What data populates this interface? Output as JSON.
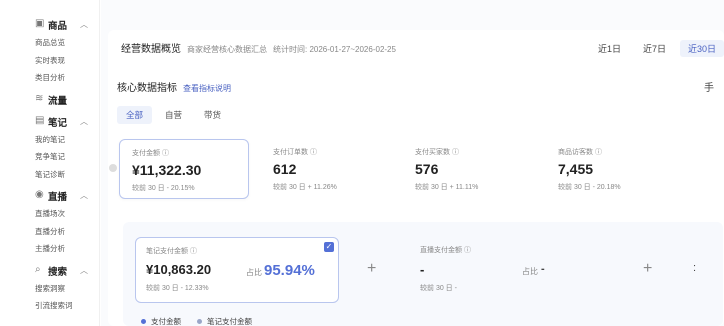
{
  "sidebar": {
    "sections": [
      {
        "label": "商品",
        "icon": "bag-icon",
        "items": [
          "商品总览",
          "实时表现",
          "类目分析"
        ]
      },
      {
        "label": "流量",
        "icon": "flow-icon",
        "items": []
      },
      {
        "label": "笔记",
        "icon": "note-icon",
        "items": [
          "我的笔记",
          "竞争笔记",
          "笔记诊断"
        ]
      },
      {
        "label": "直播",
        "icon": "live-icon",
        "items": [
          "直播场次",
          "直播分析",
          "主播分析"
        ]
      },
      {
        "label": "搜索",
        "icon": "search-icon",
        "items": [
          "搜索洞察",
          "引流搜索词"
        ]
      }
    ]
  },
  "header": {
    "title": "经营数据概览",
    "subtitle": "商家经营核心数据汇总",
    "time": "统计时间: 2026-01-27~2026-02-25"
  },
  "ranges": [
    "近1日",
    "近7日",
    "近30日"
  ],
  "core": {
    "title": "核心数据指标",
    "link": "查看指标说明",
    "right": "手"
  },
  "tabs": [
    "全部",
    "自营",
    "带货"
  ],
  "metrics": [
    {
      "label": "支付金额 ⓘ",
      "value": "¥11,322.30",
      "compare": "较前 30 日 - 20.15%"
    },
    {
      "label": "支付订单数 ⓘ",
      "value": "612",
      "compare": "较前 30 日 + 11.26%"
    },
    {
      "label": "支付买家数 ⓘ",
      "value": "576",
      "compare": "较前 30 日 + 11.11%"
    },
    {
      "label": "商品访客数 ⓘ",
      "value": "7,455",
      "compare": "较前 30 日 - 20.18%"
    }
  ],
  "lower": {
    "card1": {
      "label": "笔记支付金额 ⓘ",
      "value": "¥10,863.20",
      "ratio_label": "占比",
      "ratio": "95.94%",
      "compare": "较前 30 日 - 12.33%"
    },
    "card2": {
      "label": "直播支付金额 ⓘ",
      "value": "-",
      "ratio_label": "占比",
      "ratio": "-",
      "compare": "较前 30 日 -"
    },
    "plus": "+"
  },
  "legend": [
    {
      "label": "支付金额",
      "color": "#5470d6"
    },
    {
      "label": "笔记支付金额",
      "color": "#9aa6c8"
    }
  ],
  "colors": {
    "accent": "#5470d6",
    "border": "#b9c6ee"
  }
}
